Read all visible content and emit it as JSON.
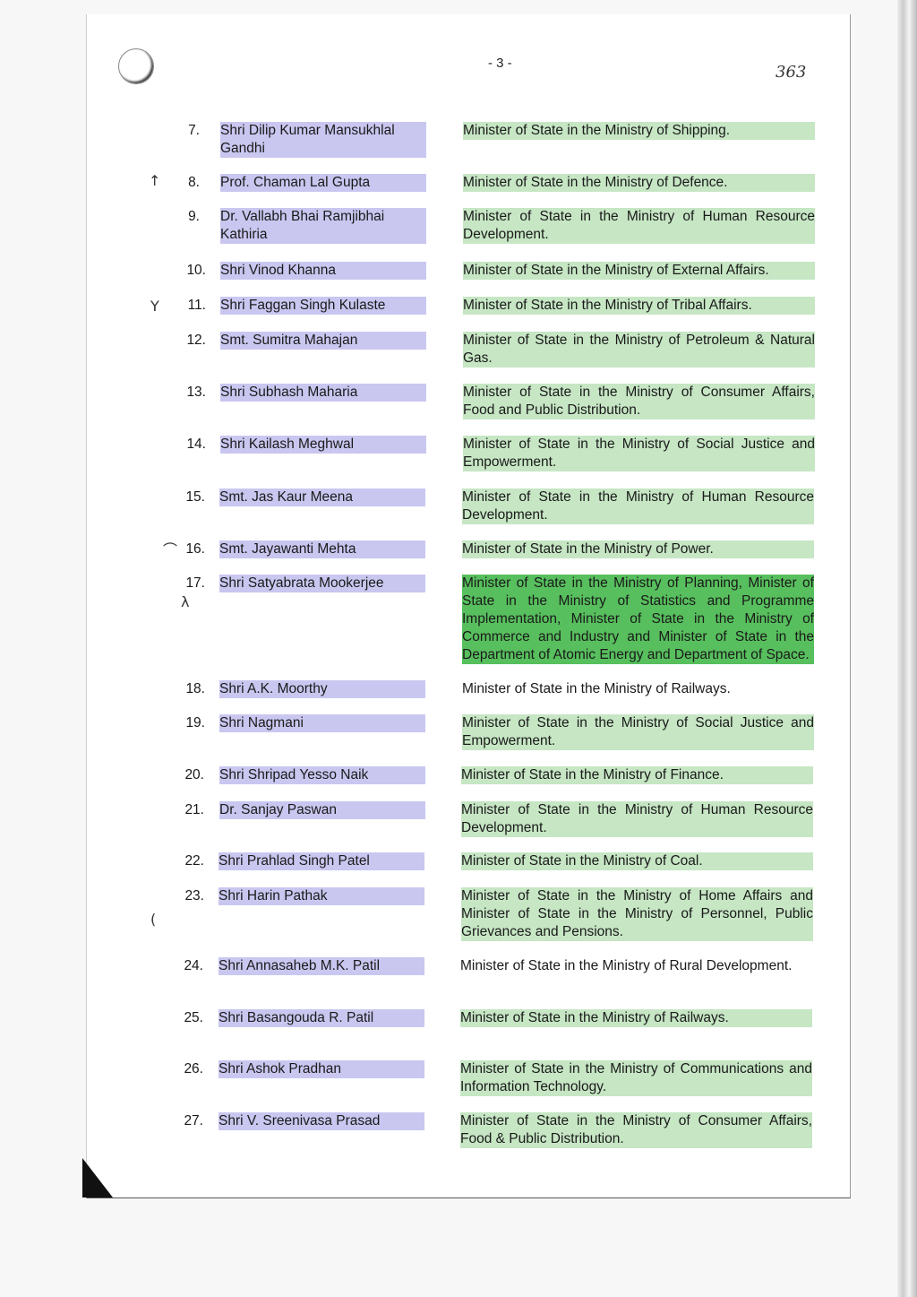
{
  "header": {
    "page_number": "- 3 -",
    "handwritten_ref": "363"
  },
  "entries": [
    {
      "num": "7.",
      "name": "Shri Dilip Kumar Mansukhlal Gandhi",
      "role": "Minister of State in the Ministry of Shipping."
    },
    {
      "num": "8.",
      "name": "Prof. Chaman Lal Gupta",
      "role": "Minister of State in the Ministry of Defence."
    },
    {
      "num": "9.",
      "name": "Dr. Vallabh Bhai Ramjibhai Kathiria",
      "role": "Minister of State in the Ministry of Human Resource Development."
    },
    {
      "num": "10.",
      "name": "Shri Vinod Khanna",
      "role": "Minister of State in the Ministry of External Affairs."
    },
    {
      "num": "11.",
      "name": "Shri Faggan Singh Kulaste",
      "role": "Minister of State in the Ministry of Tribal Affairs."
    },
    {
      "num": "12.",
      "name": "Smt. Sumitra Mahajan",
      "role": "Minister of State in the Ministry of Petroleum & Natural Gas."
    },
    {
      "num": "13.",
      "name": "Shri Subhash Maharia",
      "role": "Minister of State in the Ministry of Consumer Affairs, Food and Public Distribution."
    },
    {
      "num": "14.",
      "name": "Shri Kailash Meghwal",
      "role": "Minister of State in the Ministry of Social Justice and Empowerment."
    },
    {
      "num": "15.",
      "name": "Smt. Jas Kaur Meena",
      "role": "Minister of State in the Ministry of Human Resource Development."
    },
    {
      "num": "16.",
      "name": "Smt. Jayawanti Mehta",
      "role": "Minister of State in the Ministry of Power."
    },
    {
      "num": "17.",
      "name": "Shri Satyabrata Mookerjee",
      "role": "Minister of State in the Ministry of Planning, Minister of State in the Ministry of Statistics and Programme Implementation, Minister of State in the Ministry of Commerce and Industry and Minister of State in the Department of Atomic Energy and Department of Space."
    },
    {
      "num": "18.",
      "name": "Shri A.K. Moorthy",
      "role": "Minister of State in the Ministry of Railways."
    },
    {
      "num": "19.",
      "name": "Shri Nagmani",
      "role": "Minister of State in the Ministry of Social Justice and Empowerment."
    },
    {
      "num": "20.",
      "name": "Shri Shripad Yesso Naik",
      "role": "Minister of State in the Ministry of Finance."
    },
    {
      "num": "21.",
      "name": "Dr. Sanjay Paswan",
      "role": "Minister of State in the Ministry of Human Resource Development."
    },
    {
      "num": "22.",
      "name": "Shri Prahlad Singh Patel",
      "role": "Minister of State in the Ministry of Coal."
    },
    {
      "num": "23.",
      "name": "Shri Harin Pathak",
      "role": "Minister of State in the Ministry of Home Affairs and Minister of State in the Ministry of Personnel, Public Grievances and Pensions."
    },
    {
      "num": "24.",
      "name": "Shri Annasaheb M.K. Patil",
      "role": "Minister of State in the Ministry of Rural Development."
    },
    {
      "num": "25.",
      "name": "Shri Basangouda R. Patil",
      "role": "Minister of State in the Ministry of Railways."
    },
    {
      "num": "26.",
      "name": "Shri Ashok Pradhan",
      "role": "Minister of State in the Ministry of Communications and Information Technology."
    },
    {
      "num": "27.",
      "name": "Shri V. Sreenivasa Prasad",
      "role": "Minister of State in the Ministry of Consumer Affairs, Food & Public Distribution."
    }
  ],
  "colors": {
    "name_highlight": "#c9c7f0",
    "role_highlight": "#c6e6c4",
    "strong_highlight": "#57bf5d"
  }
}
